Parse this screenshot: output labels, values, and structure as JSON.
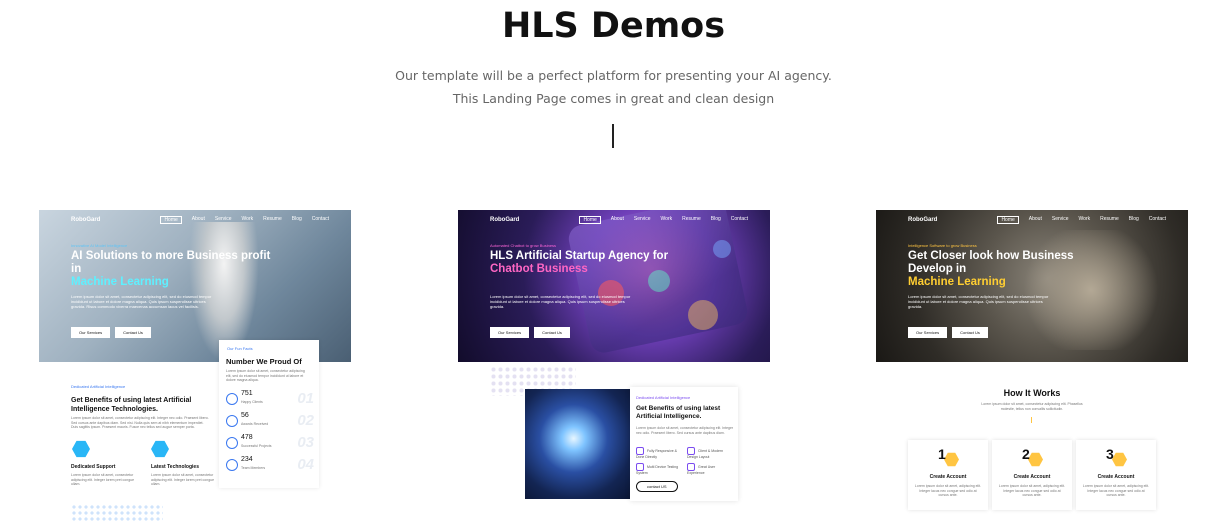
{
  "page": {
    "title": "HLS Demos",
    "subtitle": "Our template will be a perfect platform for presenting your AI agency. This Landing Page comes in great and clean design"
  },
  "demos": [
    {
      "logo": "RoboGard",
      "menu": [
        "Home",
        "About",
        "Service",
        "Work",
        "Resume",
        "Blog",
        "Contact"
      ],
      "tagline": "Innovative AI Model Intelligence",
      "headline": "AI Solutions to more Business profit in",
      "headline_accent": "Machine Learning",
      "description": "Lorem ipsum dolor sit amet, consectetur adipiscing elit, sed do eiusmod tempor incididunt ut labore et dolore magna aliqua. Quis ipsum suspendisse ultrices gravida. Risus commodo viverra maecenas accumsan lacus vel facilisis.",
      "button_primary": "Our Services",
      "button_secondary": "Contact Us",
      "stats": {
        "tag": "Our Fun Facts",
        "title": "Number We Proud Of",
        "text": "Lorem ipsum dolor sit amet, consectetur adipiscing elit, sed do eiusmod tempor incididunt ut labore et dolore magna aliqua.",
        "items": [
          {
            "value": "751",
            "label": "Happy Clients",
            "num": "01"
          },
          {
            "value": "56",
            "label": "Awards Received",
            "num": "02"
          },
          {
            "value": "478",
            "label": "Successful Projects",
            "num": "03"
          },
          {
            "value": "234",
            "label": "Team Members",
            "num": "04"
          }
        ]
      },
      "benefits": {
        "tag": "Dedicated Artificial Intelligence",
        "title": "Get Benefits of using latest Artificial Intelligence Technologies.",
        "text": "Lorem ipsum dolor sit amet, consectetur adipiscing elit. Integer nec odio. Praesent libero. Sed cursus ante dapibus diam. Sed nisi. Nulla quis sem at nibh elementum imperdiet. Duis sagittis ipsum. Praesent mauris. Fusce nec tellus sed augue semper porta.",
        "features": [
          {
            "title": "Dedicated Support",
            "text": "Lorem ipsum dolor sit amet, consectetur adipiscing elit. Integer lorem pret congue ullam."
          },
          {
            "title": "Latest Technologies",
            "text": "Lorem ipsum dolor sit amet, consectetur adipiscing elit. Integer lorem pret congue ullam."
          }
        ]
      }
    },
    {
      "logo": "RoboGard",
      "menu": [
        "Home",
        "About",
        "Service",
        "Work",
        "Resume",
        "Blog",
        "Contact"
      ],
      "tagline": "Automated Chatbot to grow Business",
      "headline": "HLS Artificial Startup Agency for",
      "headline_accent": "Chatbot Business",
      "description": "Lorem ipsum dolor sit amet, consectetur adipiscing elit, sed do eiusmod tempor incididunt ut labore et dolore magna aliqua. Quis ipsum suspendisse ultrices gravida.",
      "button_primary": "Our Services",
      "button_secondary": "Contact Us",
      "panel": {
        "tag": "Dedicated Artificial Intelligence",
        "title": "Get Benefits of using latest Artificial Intelligence.",
        "text": "Lorem ipsum dolor sit amet, consectetur adipiscing elit. Integer nec odio. Praesent libero. Sed cursus ante dapibus diam.",
        "features": [
          "Fully Responsive & Done Directly",
          "Client & Modern Design Layout",
          "Multi Device Testing System",
          "Great User Experience"
        ],
        "button": "contact US"
      }
    },
    {
      "logo": "RoboGard",
      "menu": [
        "Home",
        "About",
        "Service",
        "Work",
        "Resume",
        "Blog",
        "Contact"
      ],
      "tagline": "Intelligence Software to grow Business",
      "headline": "Get Closer look how Business Develop in",
      "headline_accent": "Machine Learning",
      "description": "Lorem ipsum dolor sit amet, consectetur adipiscing elit, sed do eiusmod tempor incididunt ut labore et dolore magna aliqua. Quis ipsum suspendisse ultrices gravida.",
      "button_primary": "Our Services",
      "button_secondary": "Contact Us",
      "how": {
        "title": "How It Works",
        "text": "Lorem ipsum dolor sit amet, consectetur adipiscing elit. Phasellus molestie, tellus non convallis sollicitudin.",
        "steps": [
          {
            "num": "1",
            "title": "Create Account",
            "text": "Lorem ipsum dolor sit amet, adipiscing elit. Integer lacus nec congue sed odio at cursus ante."
          },
          {
            "num": "2",
            "title": "Create Account",
            "text": "Lorem ipsum dolor sit amet, adipiscing elit. Integer lacus nec congue sed odio at cursus ante."
          },
          {
            "num": "3",
            "title": "Create Account",
            "text": "Lorem ipsum dolor sit amet, adipiscing elit. Integer lacus nec congue sed odio at cursus ante."
          }
        ]
      }
    }
  ]
}
